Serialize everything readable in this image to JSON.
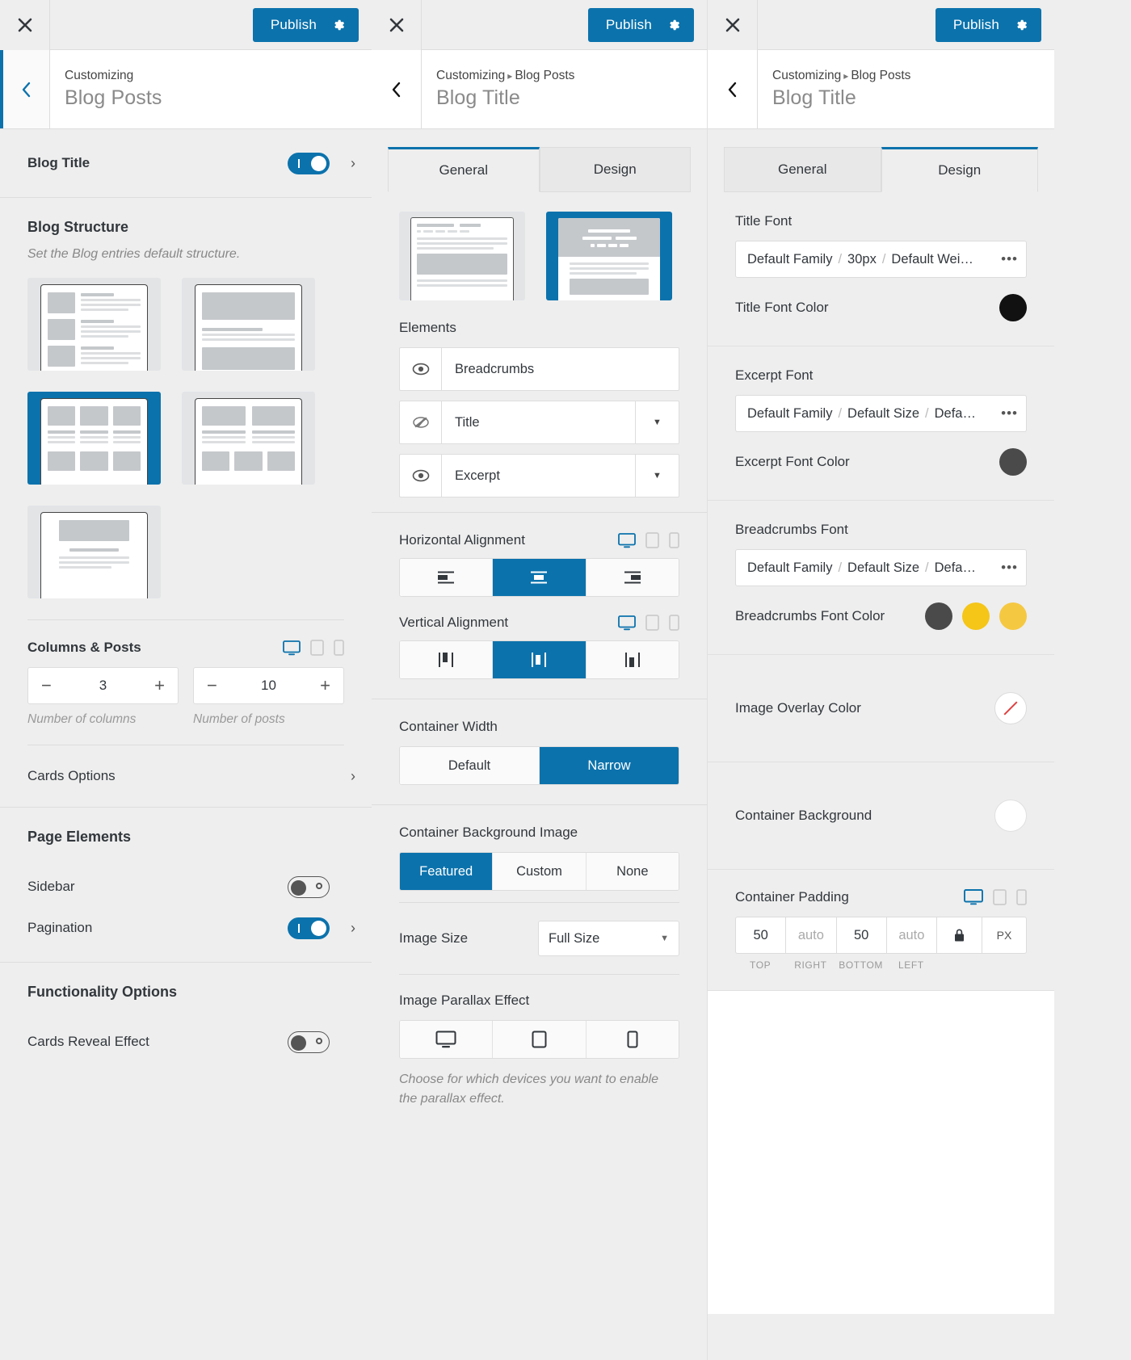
{
  "colors": {
    "accent": "#0b72ac",
    "title_font_color": "#111111",
    "excerpt_font_color": "#4a4a4a",
    "breadcrumbs_colors": [
      "#4a4a4a",
      "#f5c518",
      "#f5c842"
    ],
    "image_overlay_slash": "#e04040"
  },
  "topbar": {
    "close_label": "×",
    "publish_label": "Publish",
    "gear_icon": "gear-icon",
    "close_icon": "close-icon"
  },
  "panel1": {
    "breadcrumb": "Customizing",
    "title": "Blog Posts",
    "blog_title_row": {
      "label": "Blog Title",
      "toggle": "on"
    },
    "blog_structure": {
      "title": "Blog Structure",
      "description": "Set the Blog entries default structure.",
      "options": [
        {
          "name": "list-layout",
          "selected": false
        },
        {
          "name": "single-wide-layout",
          "selected": false
        },
        {
          "name": "three-column-grid-layout",
          "selected": true
        },
        {
          "name": "two-column-grid-layout",
          "selected": false
        },
        {
          "name": "centered-narrow-layout",
          "selected": false
        }
      ]
    },
    "columns_posts": {
      "label": "Columns & Posts",
      "devices": [
        "desktop",
        "tablet",
        "mobile"
      ],
      "active_device": "desktop",
      "columns_value": "3",
      "columns_help": "Number of columns",
      "posts_value": "10",
      "posts_help": "Number of posts",
      "minus": "−",
      "plus": "+"
    },
    "cards_options": {
      "label": "Cards Options"
    },
    "page_elements": {
      "title": "Page Elements",
      "sidebar": {
        "label": "Sidebar",
        "toggle": "off"
      },
      "pagination": {
        "label": "Pagination",
        "toggle": "on"
      }
    },
    "functionality_options": {
      "title": "Functionality Options",
      "cards_reveal": {
        "label": "Cards Reveal Effect",
        "toggle": "off"
      }
    }
  },
  "panel2": {
    "breadcrumb_parent": "Customizing",
    "breadcrumb_sep": "▸",
    "breadcrumb_current": "Blog Posts",
    "title": "Blog Title",
    "tabs": [
      {
        "label": "General",
        "active": true
      },
      {
        "label": "Design",
        "active": false
      }
    ],
    "presets": [
      {
        "name": "standard-title-preset",
        "selected": false
      },
      {
        "name": "hero-title-preset",
        "selected": true
      }
    ],
    "elements": {
      "label": "Elements",
      "items": [
        {
          "label": "Breadcrumbs",
          "visible": true,
          "has_caret": false
        },
        {
          "label": "Title",
          "visible": false,
          "has_caret": true
        },
        {
          "label": "Excerpt",
          "visible": true,
          "has_caret": true
        }
      ]
    },
    "horizontal_alignment": {
      "label": "Horizontal Alignment",
      "devices": [
        "desktop",
        "tablet",
        "mobile"
      ],
      "active_device": "desktop",
      "options": [
        "align-left",
        "align-center",
        "align-right"
      ],
      "selected": "align-center"
    },
    "vertical_alignment": {
      "label": "Vertical Alignment",
      "devices": [
        "desktop",
        "tablet",
        "mobile"
      ],
      "active_device": "desktop",
      "options": [
        "valign-top",
        "valign-middle",
        "valign-bottom"
      ],
      "selected": "valign-middle"
    },
    "container_width": {
      "label": "Container Width",
      "options": [
        "Default",
        "Narrow"
      ],
      "selected": "Narrow"
    },
    "container_bg_image": {
      "label": "Container Background Image",
      "options": [
        "Featured",
        "Custom",
        "None"
      ],
      "selected": "Featured"
    },
    "image_size": {
      "label": "Image Size",
      "value": "Full Size"
    },
    "image_parallax": {
      "label": "Image Parallax Effect",
      "options": [
        "desktop",
        "tablet",
        "mobile"
      ],
      "note": "Choose for which devices you want to enable the parallax effect."
    }
  },
  "panel3": {
    "breadcrumb_parent": "Customizing",
    "breadcrumb_sep": "▸",
    "breadcrumb_current": "Blog Posts",
    "title": "Blog Title",
    "tabs": [
      {
        "label": "General",
        "active": false
      },
      {
        "label": "Design",
        "active": true
      }
    ],
    "title_font": {
      "label": "Title Font",
      "family": "Default Family",
      "size": "30px",
      "weight": "Default Wei…",
      "more": "•••"
    },
    "title_font_color": {
      "label": "Title Font Color"
    },
    "excerpt_font": {
      "label": "Excerpt Font",
      "family": "Default Family",
      "size": "Default Size",
      "weight": "Defa…",
      "more": "•••"
    },
    "excerpt_font_color": {
      "label": "Excerpt Font Color"
    },
    "breadcrumbs_font": {
      "label": "Breadcrumbs Font",
      "family": "Default Family",
      "size": "Default Size",
      "weight": "Defa…",
      "more": "•••"
    },
    "breadcrumbs_font_color": {
      "label": "Breadcrumbs Font Color"
    },
    "image_overlay_color": {
      "label": "Image Overlay Color"
    },
    "container_background": {
      "label": "Container Background"
    },
    "container_padding": {
      "label": "Container Padding",
      "devices": [
        "desktop",
        "tablet",
        "mobile"
      ],
      "active_device": "desktop",
      "values": [
        {
          "value": "50",
          "caption": "TOP",
          "placeholder": false
        },
        {
          "value": "auto",
          "caption": "RIGHT",
          "placeholder": true
        },
        {
          "value": "50",
          "caption": "BOTTOM",
          "placeholder": false
        },
        {
          "value": "auto",
          "caption": "LEFT",
          "placeholder": true
        }
      ],
      "unit": "PX",
      "lock_icon": "lock-icon"
    }
  }
}
